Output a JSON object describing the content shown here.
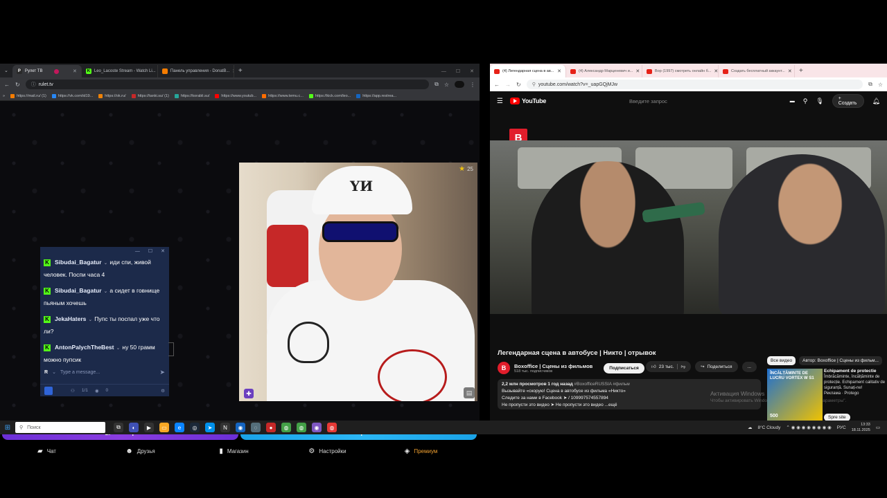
{
  "left_browser": {
    "tabs": [
      {
        "label": "Рулет ТВ",
        "active": true,
        "color": "#2a2a2a"
      },
      {
        "label": "Leo_Lacoste Stream - Watch Li...",
        "active": false,
        "color": "#53fc18"
      },
      {
        "label": "Панель управления - DonatB...",
        "active": false,
        "color": "#f57c00"
      }
    ],
    "new_tab": "+",
    "url": "rulet.tv",
    "bookmarks": [
      {
        "label": "https://mail.ru/ (1)",
        "color": "#f57c00"
      },
      {
        "label": "https://vk.com/id19...",
        "color": "#2787f5"
      },
      {
        "label": "https://ok.ru/",
        "color": "#ee8208"
      },
      {
        "label": "https://tanki.su/ (1)",
        "color": "#c62828"
      },
      {
        "label": "https://korabli.su/",
        "color": "#26a69a"
      },
      {
        "label": "https://www.youtub...",
        "color": "#ff0000"
      },
      {
        "label": "https://www.temu.c...",
        "color": "#ff6d00"
      },
      {
        "label": "https://kick.com/leo...",
        "color": "#53fc18"
      },
      {
        "label": "https://app.restrea...",
        "color": "#1565c0"
      }
    ]
  },
  "webcam": {
    "star_count": "25",
    "cap_text": "YИ"
  },
  "chat": {
    "messages": [
      {
        "user": "Sibudai_Bagatur",
        "text": "иди спи, живой человек. Поспи часа 4"
      },
      {
        "user": "Sibudai_Bagatur",
        "text": "а сидет в говнище пьяным хочешь"
      },
      {
        "user": "JekaHaters",
        "text": "Пупс ты поспал уже что ли?"
      },
      {
        "user": "AntonPalychTheBest",
        "text": "ну 50 грамм можно пупсик"
      }
    ],
    "avatar_letter": "R",
    "input_placeholder": "Type a message...",
    "users_count": "1/1",
    "viewers_count": "0"
  },
  "actions": {
    "filter_label": "Фильтр",
    "start_label": "Старт"
  },
  "bottom_nav": [
    {
      "label": "Чат",
      "icon": "chat-icon"
    },
    {
      "label": "Друзья",
      "icon": "friends-icon"
    },
    {
      "label": "Магазин",
      "icon": "shop-icon"
    },
    {
      "label": "Настройки",
      "icon": "gear-icon"
    },
    {
      "label": "Премиум",
      "icon": "premium-icon"
    }
  ],
  "right_browser": {
    "tabs": [
      {
        "label": "(4) Легендарная сцена в ав...",
        "active": true
      },
      {
        "label": "(4) Александр Марценевич и...",
        "active": false
      },
      {
        "label": "Вор (1997) смотреть онлайн б...",
        "active": false
      },
      {
        "label": "Создать бесплатный аккаунт...",
        "active": false
      }
    ],
    "url": "youtube.com/watch?v=_uapGQjMJw"
  },
  "youtube": {
    "logo": "YouTube",
    "search_placeholder": "Введите запрос",
    "create_label": "Создать",
    "video_badge": "B",
    "title": "Легендарная сцена в автобусе | Никто | отрывок",
    "channel_name": "Boxoffice | Сцены из фильмов",
    "channel_subs": "518 тыс. подписчиков",
    "subscribe_label": "Подписаться",
    "likes": "23 тыс.",
    "share_label": "Поделиться",
    "more_label": "...",
    "desc_stats": "2,2 млн просмотров  1 год назад",
    "desc_tags": "#BoxofficeRUSSIA #фильм",
    "desc_line1": "Вызывайте «скорую! Сцена в автобусе из фильма «Никто»",
    "desc_line2": "Следите за нами в Facebook ➤ / 109997574557894",
    "desc_line3": "Не пропусти это видео ➤ Не пропусти это видео ...ещё",
    "filters": [
      "Все видео",
      "Автор: Boxoffice | Сцены из фильм..."
    ],
    "ad": {
      "img_title": "ÎNCĂLȚĂMINTE DE LUCRU VORTEX W S1",
      "img_price": "500",
      "headline": "Echipament de protectie",
      "body": "Îmbrăcăminte, încălțăminte de protecție. Echipament calitativ de siguranță. Sunați-ne!",
      "sponsor": "Реклама · Protego",
      "button": "Spre site"
    },
    "watermark_title": "Активация Windows",
    "watermark_sub": "Чтобы активировать Windows, перейдите в раздел \"Параметры\"."
  },
  "taskbar": {
    "search_placeholder": "Поиск",
    "weather": "8°C  Cloudy",
    "lang": "РУС",
    "time": "13:33",
    "date": "18.11.2025"
  }
}
